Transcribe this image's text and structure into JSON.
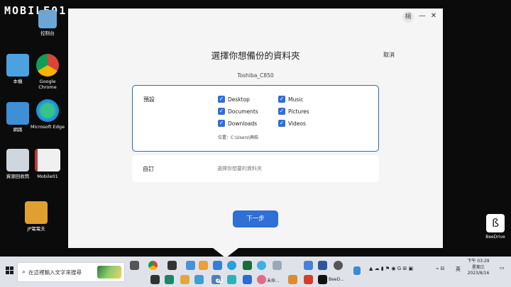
{
  "watermark": "MOBILE01",
  "desktop_icons": [
    {
      "label": "控制台",
      "color": "#6aa7d6"
    },
    {
      "label": "本機",
      "color": "#4aa3e0"
    },
    {
      "label": "Google Chrome",
      "color": "#e9b12a"
    },
    {
      "label": "網路",
      "color": "#3d8fd6"
    },
    {
      "label": "Microsoft Edge",
      "color": "#1f9be0"
    },
    {
      "label": "資源回收筒",
      "color": "#cfd6de"
    },
    {
      "label": "Mobile01",
      "color": "#c43a3a"
    },
    {
      "label": "JP電電夫",
      "color": "#e0a030"
    }
  ],
  "dialog": {
    "avatar": "楊",
    "minimize": "—",
    "close": "✕",
    "title": "選擇你想備份的資料夾",
    "cancel": "取消",
    "device": "Toshiba_C850",
    "default_label": "預設",
    "folders_col1": [
      "Desktop",
      "Documents",
      "Downloads"
    ],
    "folders_col2": [
      "Music",
      "Pictures",
      "Videos"
    ],
    "location": "位置：C:\\Users\\興皓",
    "custom_label": "自訂",
    "custom_hint": "選擇你想要的資料夾",
    "next": "下一步"
  },
  "taskbar": {
    "search_placeholder": "在這裡輸入文字來搜尋",
    "labels": {
      "app1": "未命...",
      "app2": "BeeD..."
    },
    "badge": "25",
    "tray_lang": "英",
    "clock_time": "下午 03:29",
    "clock_day": "星期三",
    "clock_date": "2023/8/16"
  },
  "beedrive_label": "BeeDrive"
}
